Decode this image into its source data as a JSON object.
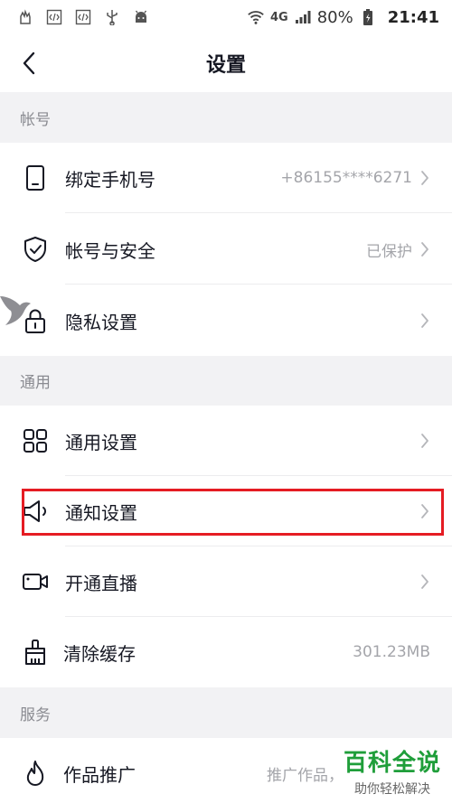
{
  "status_bar": {
    "network": "4G",
    "battery": "80%",
    "time": "21:41"
  },
  "header": {
    "title": "设置"
  },
  "sections": {
    "account": {
      "title": "帐号",
      "items": [
        {
          "label": "绑定手机号",
          "value": "+86155****6271",
          "icon": "phone-icon"
        },
        {
          "label": "帐号与安全",
          "value": "已保护",
          "icon": "shield-icon"
        },
        {
          "label": "隐私设置",
          "value": "",
          "icon": "lock-icon"
        }
      ]
    },
    "general": {
      "title": "通用",
      "items": [
        {
          "label": "通用设置",
          "value": "",
          "icon": "grid-icon"
        },
        {
          "label": "通知设置",
          "value": "",
          "icon": "speaker-icon"
        },
        {
          "label": "开通直播",
          "value": "",
          "icon": "video-camera-icon"
        },
        {
          "label": "清除缓存",
          "value": "301.23MB",
          "icon": "broom-icon"
        }
      ]
    },
    "services": {
      "title": "服务",
      "items": [
        {
          "label": "作品推广",
          "value": "推广作品，",
          "icon": "flame-icon"
        }
      ]
    }
  },
  "watermark": {
    "title": "百科全说",
    "subtitle": "助你轻松解决"
  },
  "colors": {
    "highlight": "#e51c23",
    "section_bg": "#f2f2f4",
    "watermark": "#1f9e3a"
  }
}
